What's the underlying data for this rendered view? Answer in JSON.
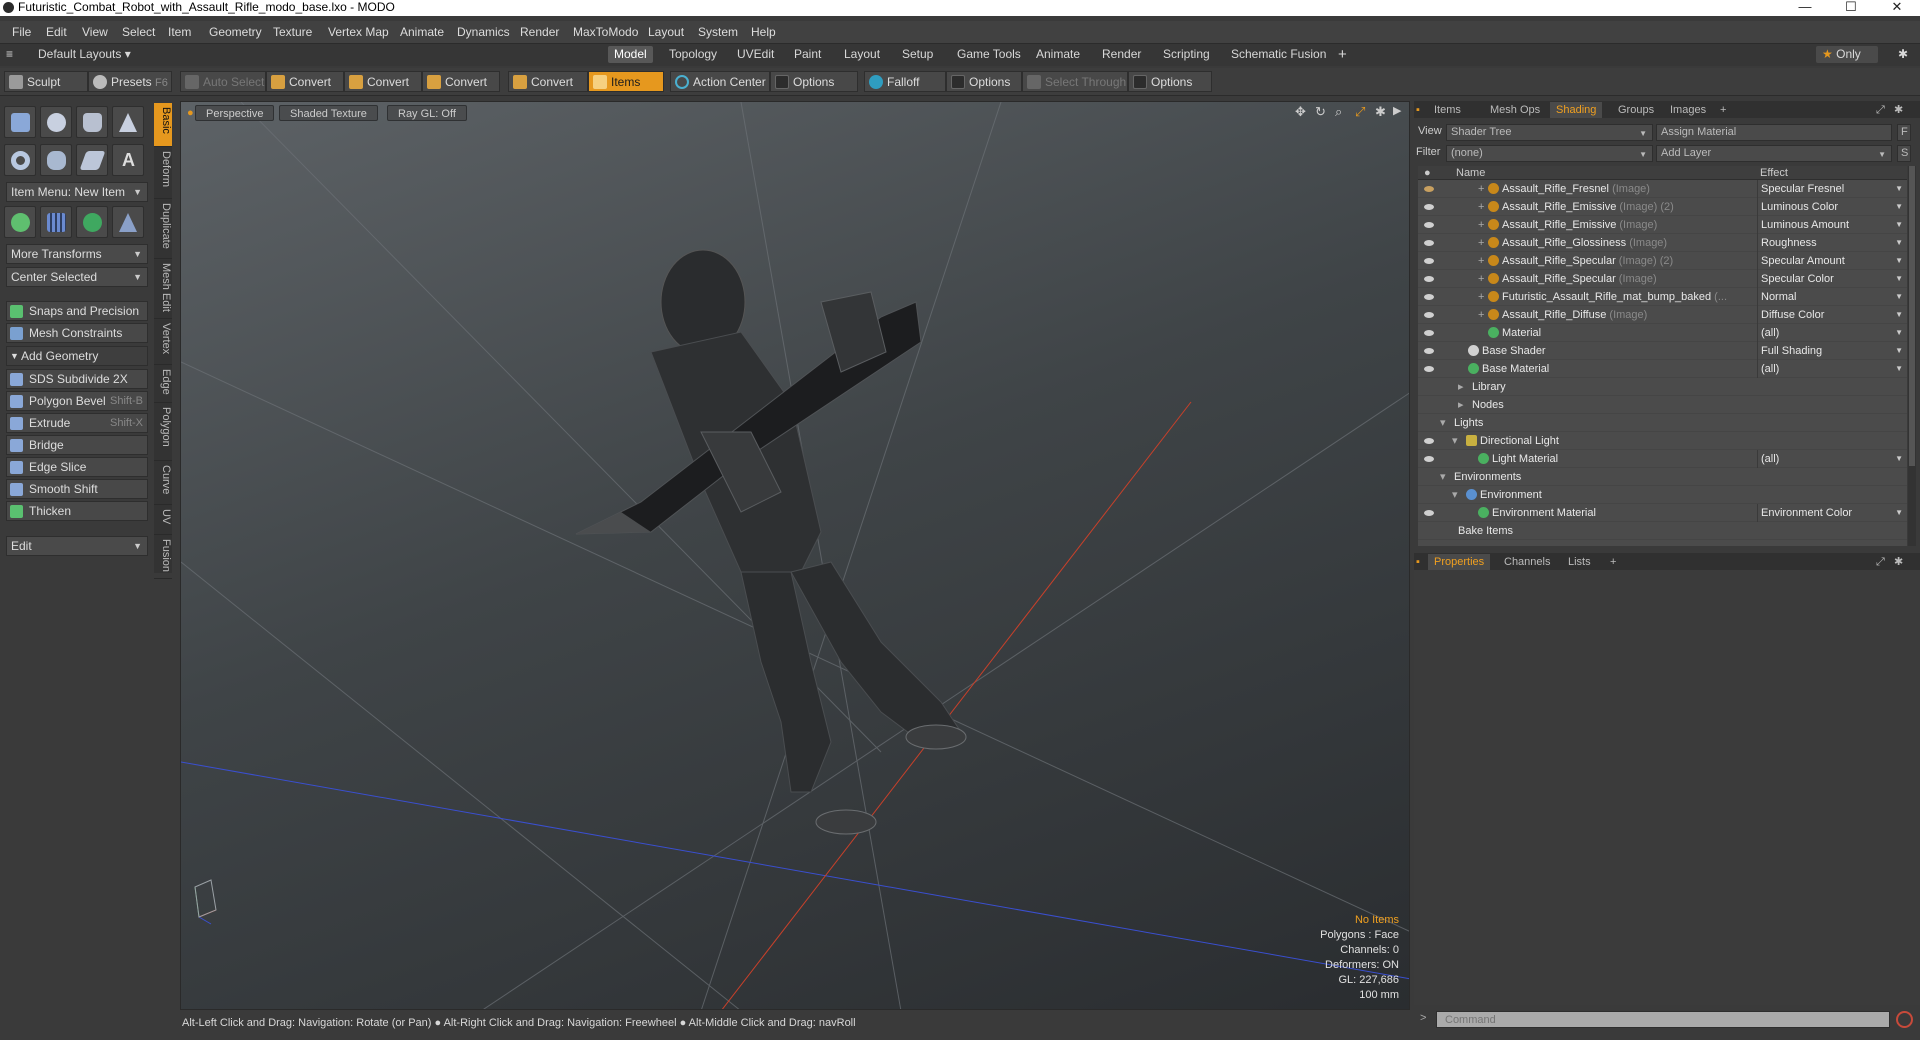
{
  "window": {
    "title": "Futuristic_Combat_Robot_with_Assault_Rifle_modo_base.lxo - MODO",
    "minimize": "—",
    "maximize": "☐",
    "close": "✕"
  },
  "menu": [
    "File",
    "Edit",
    "View",
    "Select",
    "Item",
    "Geometry",
    "Texture",
    "Vertex Map",
    "Animate",
    "Dynamics",
    "Render",
    "MaxToModo",
    "Layout",
    "System",
    "Help"
  ],
  "layout": {
    "default_layouts": "Default Layouts",
    "tabs": [
      "Model",
      "Topology",
      "UVEdit",
      "Paint",
      "Layout",
      "Setup",
      "Game Tools",
      "Animate",
      "Render",
      "Scripting",
      "Schematic Fusion"
    ],
    "active_tab": "Model",
    "add": "+",
    "only": "Only"
  },
  "toolbar": {
    "sculpt": "Sculpt",
    "presets": "Presets",
    "presets_key": "F6",
    "auto_select": "Auto Select",
    "convert1": "Convert",
    "convert2": "Convert",
    "convert3": "Convert",
    "convert4": "Convert",
    "items": "Items",
    "action_center": "Action Center",
    "options1": "Options",
    "falloff": "Falloff",
    "options2": "Options",
    "select_through": "Select Through",
    "options3": "Options"
  },
  "left": {
    "item_menu": "Item Menu: New Item",
    "more_transforms": "More Transforms",
    "center_selected": "Center Selected",
    "snaps": "Snaps and Precision",
    "mesh_constraints": "Mesh Constraints",
    "add_geometry": "Add Geometry",
    "tools": [
      {
        "label": "SDS Subdivide 2X",
        "key": ""
      },
      {
        "label": "Polygon Bevel",
        "key": "Shift-B"
      },
      {
        "label": "Extrude",
        "key": "Shift-X"
      },
      {
        "label": "Bridge",
        "key": ""
      },
      {
        "label": "Edge Slice",
        "key": ""
      },
      {
        "label": "Smooth Shift",
        "key": ""
      },
      {
        "label": "Thicken",
        "key": ""
      }
    ],
    "edit": "Edit",
    "vtabs": [
      "Basic",
      "Deform",
      "Duplicate",
      "Mesh Edit",
      "Vertex",
      "Edge",
      "Polygon",
      "Curve",
      "UV",
      "Fusion"
    ]
  },
  "viewport": {
    "perspective": "Perspective",
    "shaded_texture": "Shaded Texture",
    "ray_gl": "Ray GL: Off",
    "stats": {
      "no_items": "No Items",
      "polygons": "Polygons : Face",
      "channels": "Channels: 0",
      "deformers": "Deformers: ON",
      "gl": "GL: 227,686",
      "scale": "100 mm"
    }
  },
  "status": "Alt-Left Click and Drag: Navigation: Rotate (or Pan) ● Alt-Right Click and Drag: Navigation: Freewheel ● Alt-Middle Click and Drag: navRoll",
  "right": {
    "tabs": [
      "Items",
      "Mesh Ops",
      "Shading",
      "Groups",
      "Images"
    ],
    "active_tab": "Shading",
    "view_label": "View",
    "view_value": "Shader Tree",
    "assign_material": "Assign Material",
    "filter_label": "Filter",
    "filter_value": "(none)",
    "add_layer": "Add Layer",
    "f_btn": "F",
    "s_btn": "S",
    "col_name": "Name",
    "col_effect": "Effect",
    "rows": [
      {
        "name": "Assault_Rifle_Fresnel",
        "sub": "(Image)",
        "effect": "Specular Fresnel"
      },
      {
        "name": "Assault_Rifle_Emissive",
        "sub": "(Image) (2)",
        "effect": "Luminous Color"
      },
      {
        "name": "Assault_Rifle_Emissive",
        "sub": "(Image)",
        "effect": "Luminous Amount"
      },
      {
        "name": "Assault_Rifle_Glossiness",
        "sub": "(Image)",
        "effect": "Roughness"
      },
      {
        "name": "Assault_Rifle_Specular",
        "sub": "(Image) (2)",
        "effect": "Specular Amount"
      },
      {
        "name": "Assault_Rifle_Specular",
        "sub": "(Image)",
        "effect": "Specular Color"
      },
      {
        "name": "Futuristic_Assault_Rifle_mat_bump_baked",
        "sub": "(...",
        "effect": "Normal"
      },
      {
        "name": "Assault_Rifle_Diffuse",
        "sub": "(Image)",
        "effect": "Diffuse Color"
      },
      {
        "name": "Material",
        "sub": "",
        "effect": "(all)"
      },
      {
        "name": "Base Shader",
        "sub": "",
        "effect": "Full Shading"
      },
      {
        "name": "Base Material",
        "sub": "",
        "effect": "(all)"
      },
      {
        "name": "Library",
        "sub": "",
        "effect": ""
      },
      {
        "name": "Nodes",
        "sub": "",
        "effect": ""
      },
      {
        "name": "Lights",
        "sub": "",
        "effect": ""
      },
      {
        "name": "Directional Light",
        "sub": "",
        "effect": ""
      },
      {
        "name": "Light Material",
        "sub": "",
        "effect": "(all)"
      },
      {
        "name": "Environments",
        "sub": "",
        "effect": ""
      },
      {
        "name": "Environment",
        "sub": "",
        "effect": ""
      },
      {
        "name": "Environment Material",
        "sub": "",
        "effect": "Environment Color"
      },
      {
        "name": "Bake Items",
        "sub": "",
        "effect": ""
      }
    ],
    "bottom_tabs": [
      "Properties",
      "Channels",
      "Lists"
    ],
    "bottom_active": "Properties",
    "command_placeholder": "Command"
  },
  "colors": {
    "accent": "#e6981e",
    "x_axis": "#c8402a",
    "z_axis": "#3a4fd0"
  }
}
